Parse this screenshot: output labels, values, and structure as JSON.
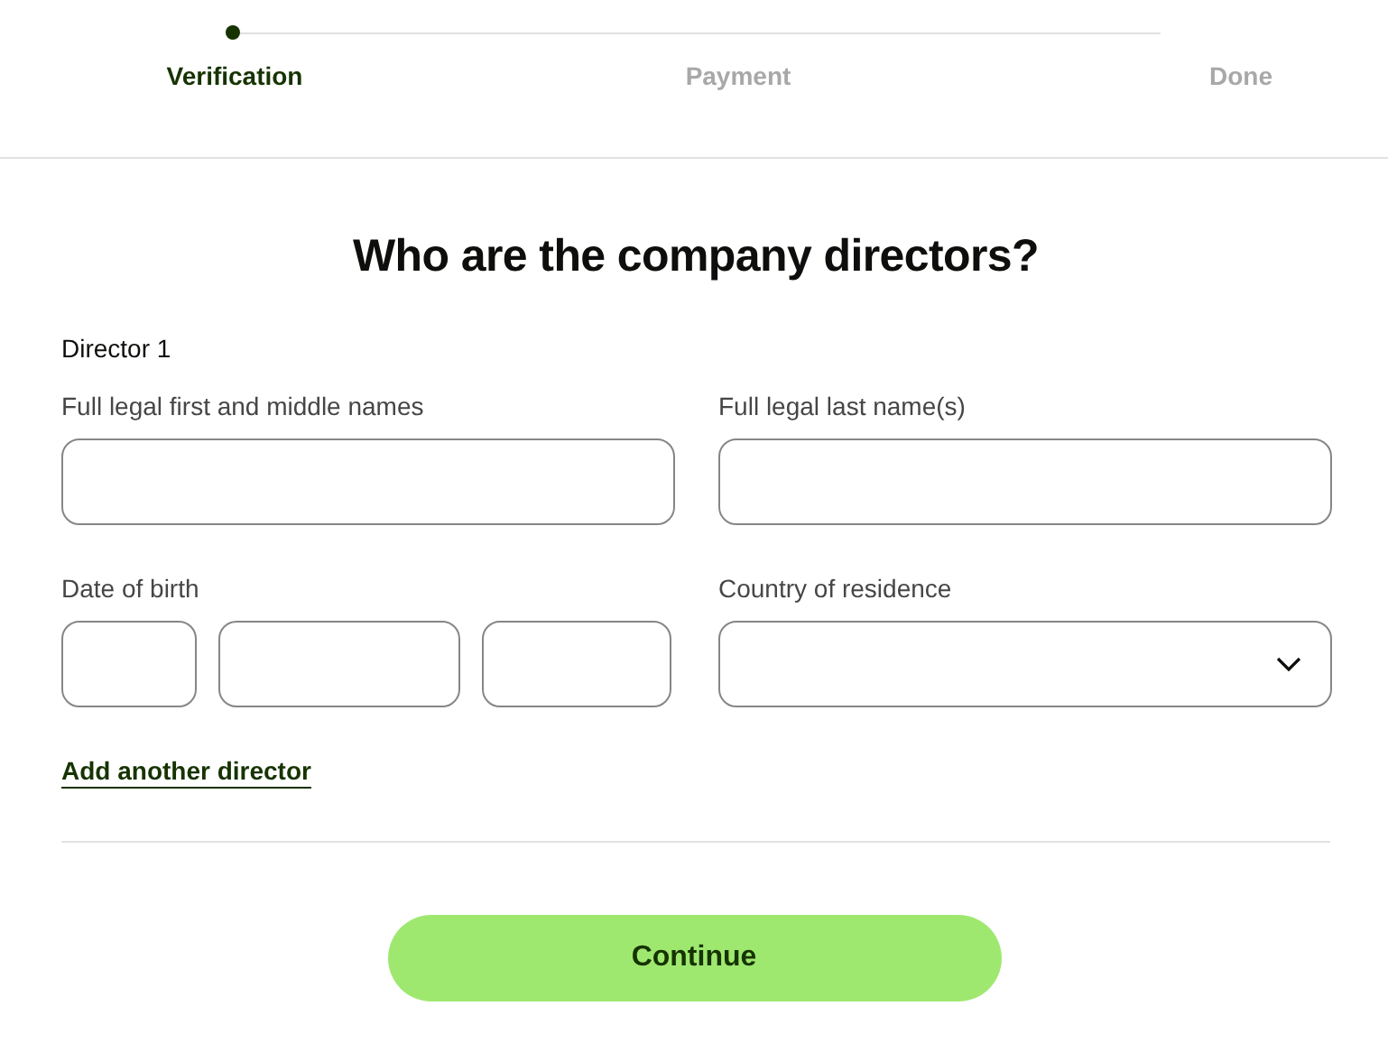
{
  "steps": [
    {
      "label": "Verification",
      "selected": true
    },
    {
      "label": "Payment",
      "selected": false
    },
    {
      "label": "Done",
      "selected": false
    }
  ],
  "title": "Who are the company directors?",
  "director": {
    "heading": "Director 1",
    "rows": [
      [
        {
          "label": "Full legal first and middle names",
          "kind": "text"
        },
        {
          "label": "Full legal last name(s)",
          "kind": "text"
        }
      ],
      [
        {
          "label": "Date of birth",
          "kind": "date"
        },
        {
          "label": "Country of residence",
          "kind": "select"
        }
      ]
    ]
  },
  "add_link": "Add another director",
  "button": "Continue"
}
